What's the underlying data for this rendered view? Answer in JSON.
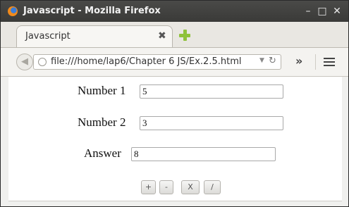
{
  "window": {
    "title": "Javascript - Mozilla Firefox",
    "controls": {
      "minimize": "–",
      "maximize": "□",
      "close": "✕"
    }
  },
  "tabs": [
    {
      "label": "Javascript",
      "close": "✖"
    }
  ],
  "navbar": {
    "url": "file:///home/lap6/Chapter 6 JS/Ex.2.5.html",
    "overflow": "»"
  },
  "form": {
    "number1": {
      "label": "Number 1",
      "value": "5"
    },
    "number2": {
      "label": "Number 2",
      "value": "3"
    },
    "answer": {
      "label": "Answer",
      "value": "8"
    },
    "buttons": {
      "add": "+",
      "subtract": "-",
      "multiply": "X",
      "divide": "/"
    }
  },
  "icons": {
    "app": "firefox-icon",
    "new_tab": "plus-icon",
    "back": "back-arrow-icon",
    "site": "globe-icon",
    "reload": "reload-icon",
    "menu": "hamburger-menu-icon"
  },
  "colors": {
    "titlebar": "#3f3f3d",
    "new_tab_plus": "#8fc23a"
  }
}
